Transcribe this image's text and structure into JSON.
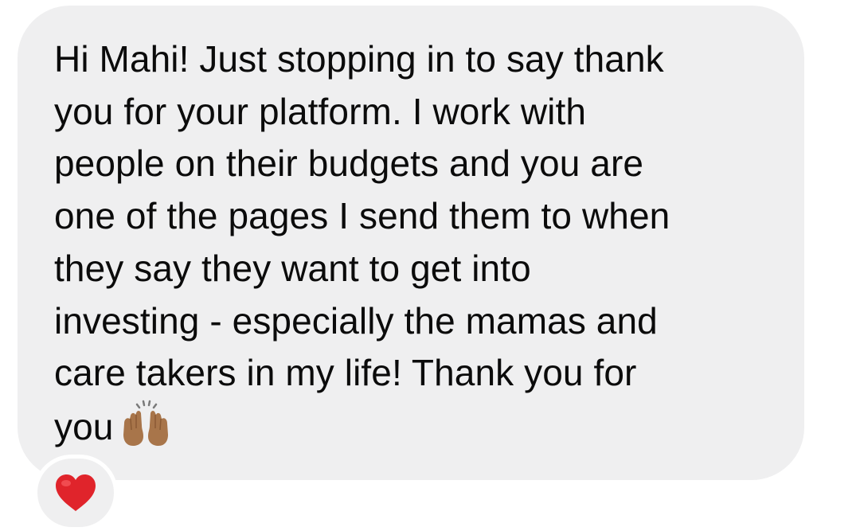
{
  "message": {
    "lines": [
      "Hi Mahi! Just stopping in to say thank",
      "you for your platform. I work with",
      "people on their budgets and you are",
      "one of the pages I send them to when",
      "they say they want to get into",
      "investing - especially the mamas and",
      "care takers in my life! Thank you for",
      "you"
    ],
    "trailing_emoji": "raising-hands-icon"
  },
  "reaction": {
    "emoji": "red-heart-icon",
    "color": "#e0242b"
  },
  "colors": {
    "bubble": "#efeff0",
    "text": "#0b0b0b",
    "background": "#ffffff"
  }
}
